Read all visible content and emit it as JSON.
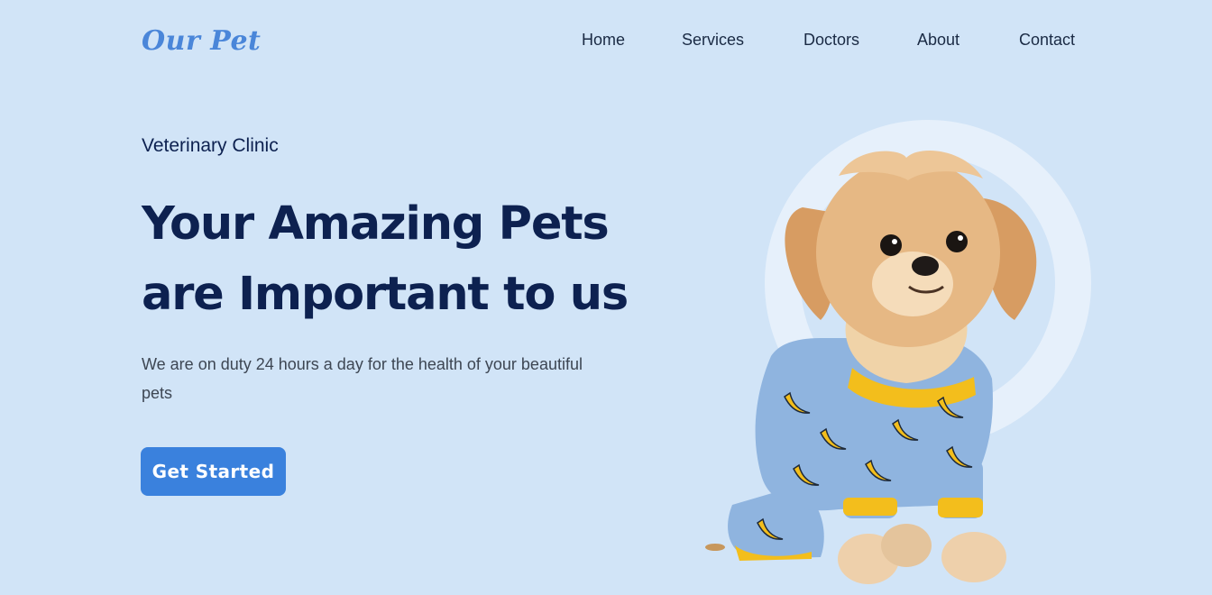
{
  "brand": {
    "logo_text": "Our Pet"
  },
  "nav": {
    "items": [
      {
        "label": "Home"
      },
      {
        "label": "Services"
      },
      {
        "label": "Doctors"
      },
      {
        "label": "About"
      },
      {
        "label": "Contact"
      }
    ]
  },
  "hero": {
    "eyebrow": "Veterinary Clinic",
    "headline_line1": "Your Amazing Pets",
    "headline_line2": "are Important to us",
    "subtext": "We are on duty 24 hours a day for the health of your beautiful pets",
    "cta_label": "Get Started"
  },
  "illustration": {
    "subject": "puppy-in-banana-pajamas",
    "icon": "dog-icon"
  },
  "colors": {
    "background": "#d1e4f7",
    "accent": "#3a81dd",
    "logo": "#4a86d9",
    "heading": "#0d2150",
    "body_text": "#3d4653",
    "ring": "#e6f0fb",
    "pajama": "#8fb4df",
    "pajama_trim": "#f3be1c",
    "fur": "#e6b884"
  }
}
